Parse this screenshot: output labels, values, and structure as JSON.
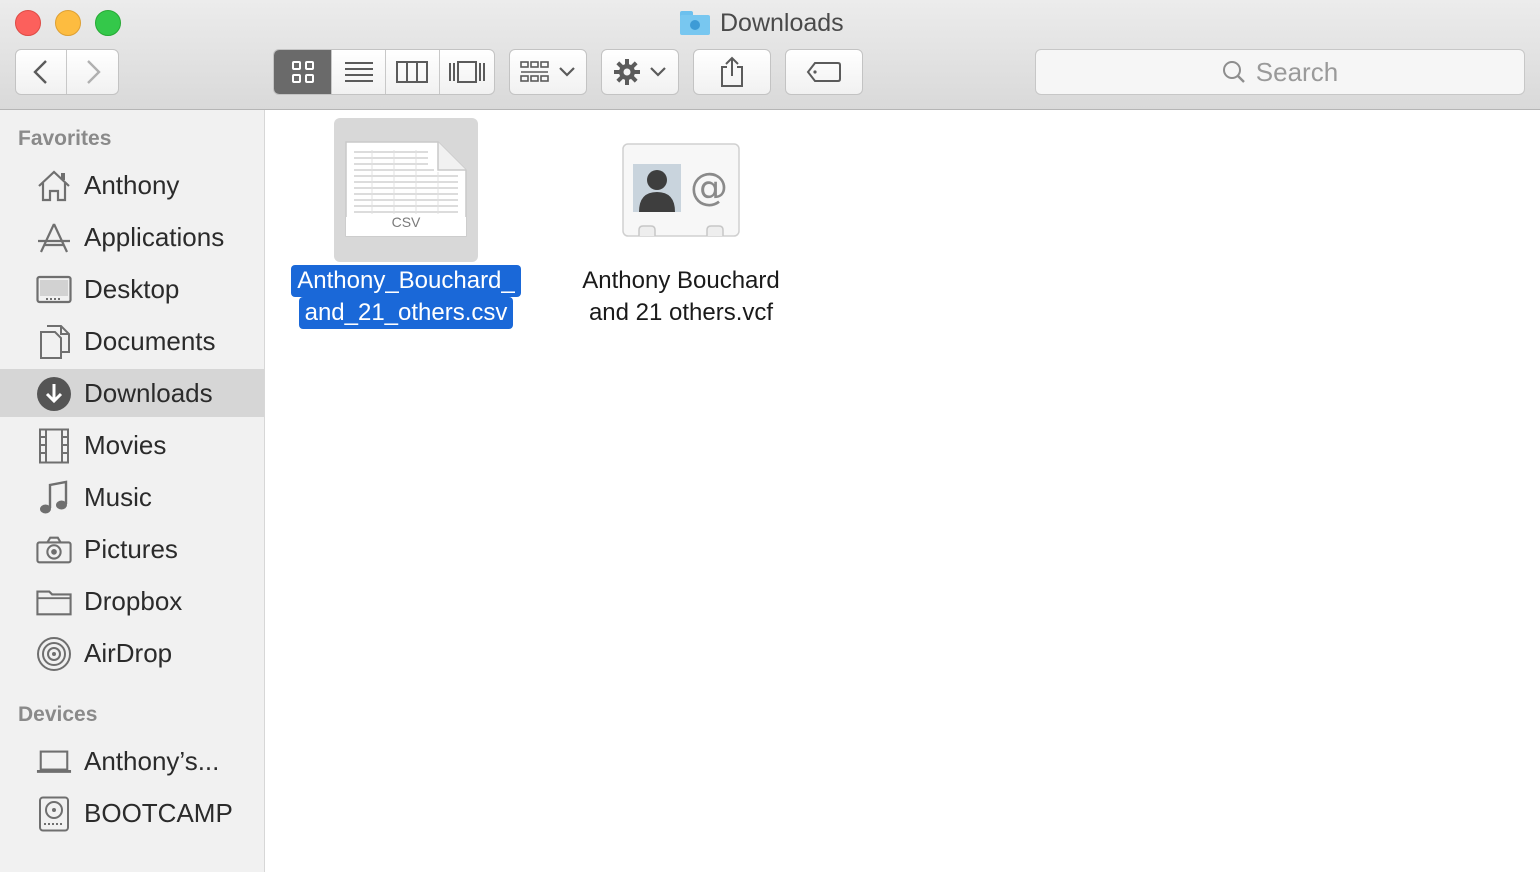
{
  "window": {
    "title": "Downloads"
  },
  "toolbar": {
    "view_modes": [
      "icon-view",
      "list-view",
      "column-view",
      "cover-flow-view"
    ],
    "active_view": "icon-view",
    "search_placeholder": "Search"
  },
  "sidebar": {
    "favorites_title": "Favorites",
    "favorites": [
      {
        "label": "Anthony",
        "icon": "home-icon"
      },
      {
        "label": "Applications",
        "icon": "applications-icon"
      },
      {
        "label": "Desktop",
        "icon": "desktop-icon"
      },
      {
        "label": "Documents",
        "icon": "documents-icon"
      },
      {
        "label": "Downloads",
        "icon": "downloads-icon",
        "selected": true
      },
      {
        "label": "Movies",
        "icon": "movies-icon"
      },
      {
        "label": "Music",
        "icon": "music-icon"
      },
      {
        "label": "Pictures",
        "icon": "camera-icon"
      },
      {
        "label": "Dropbox",
        "icon": "folder-icon"
      },
      {
        "label": "AirDrop",
        "icon": "airdrop-icon"
      }
    ],
    "devices_title": "Devices",
    "devices": [
      {
        "label": "Anthony’s...",
        "icon": "laptop-icon"
      },
      {
        "label": "BOOTCAMP",
        "icon": "disk-icon"
      }
    ]
  },
  "files": [
    {
      "line1": "Anthony_Bouchard_",
      "line2": "and_21_others.csv",
      "badge": "CSV",
      "icon": "csv-file-icon",
      "selected": true
    },
    {
      "line1": "Anthony Bouchard",
      "line2": "and 21 others.vcf",
      "icon": "vcard-file-icon",
      "selected": false
    }
  ],
  "colors": {
    "selection": "#1a68d8",
    "sidebar_bg": "#f1f1f1",
    "sidebar_selected": "#d6d6d6"
  }
}
